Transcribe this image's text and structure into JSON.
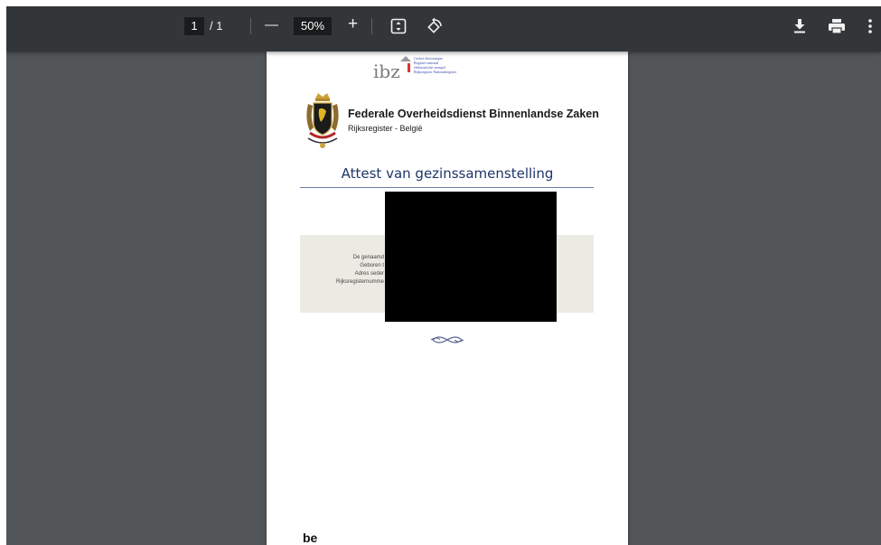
{
  "toolbar": {
    "page_current": "1",
    "page_total": "/ 1",
    "zoom_out": "—",
    "zoom_value": "50%",
    "zoom_in": "+",
    "icons": [
      "fit-page-icon",
      "rotate-icon",
      "download-icon",
      "print-icon",
      "more-vert-icon"
    ],
    "colors": {
      "bar": "#323639",
      "background": "#525659"
    }
  },
  "document": {
    "cachet_lines": [
      "Cachet électronique",
      "Registre national",
      "elektronische stempel",
      "Rijksregister Nationalregister"
    ],
    "ibz_logo": "ibz",
    "org_title": "Federale Overheidsdienst Binnenlandse Zaken",
    "org_subtitle": "Rijksregister - België",
    "title": "Attest van gezinssamenstelling",
    "info_labels": [
      "De genaamd",
      "Geboren t",
      "Adres seder",
      "Rijksregisternumme"
    ],
    "footer_logo": "be",
    "colors": {
      "title": "#1e3568",
      "infobox": "#ecebe3",
      "redaction": "#000000"
    }
  }
}
